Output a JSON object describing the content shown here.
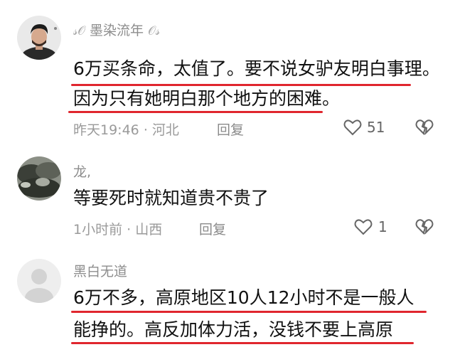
{
  "comments": [
    {
      "username": "墨染流年",
      "username_deco_left": "𝓈𝒪",
      "username_deco_right": "𝒪𝓈",
      "lines": [
        "6万买条命，太值了。要不说女驴友明白事理。",
        "因为只有她明白那个地方的困难。"
      ],
      "time": "昨天19:46",
      "separator": "·",
      "location": "河北",
      "reply_label": "回复",
      "likes": "51",
      "avatar_icon": "man-portrait-avatar"
    },
    {
      "username": "龙,",
      "lines": [
        "等要死时就知道贵不贵了"
      ],
      "time": "1小时前",
      "separator": "·",
      "location": "山西",
      "reply_label": "回复",
      "likes": "1",
      "avatar_icon": "landscape-avatar"
    },
    {
      "username": "黑白无道",
      "lines": [
        "6万不多，高原地区10人12小时不是一般人",
        "能挣的。高反加体力活，没钱不要上高原"
      ],
      "avatar_icon": "default-user-avatar"
    }
  ],
  "colors": {
    "underline": "#e0262e",
    "meta": "#9a9a9a"
  }
}
